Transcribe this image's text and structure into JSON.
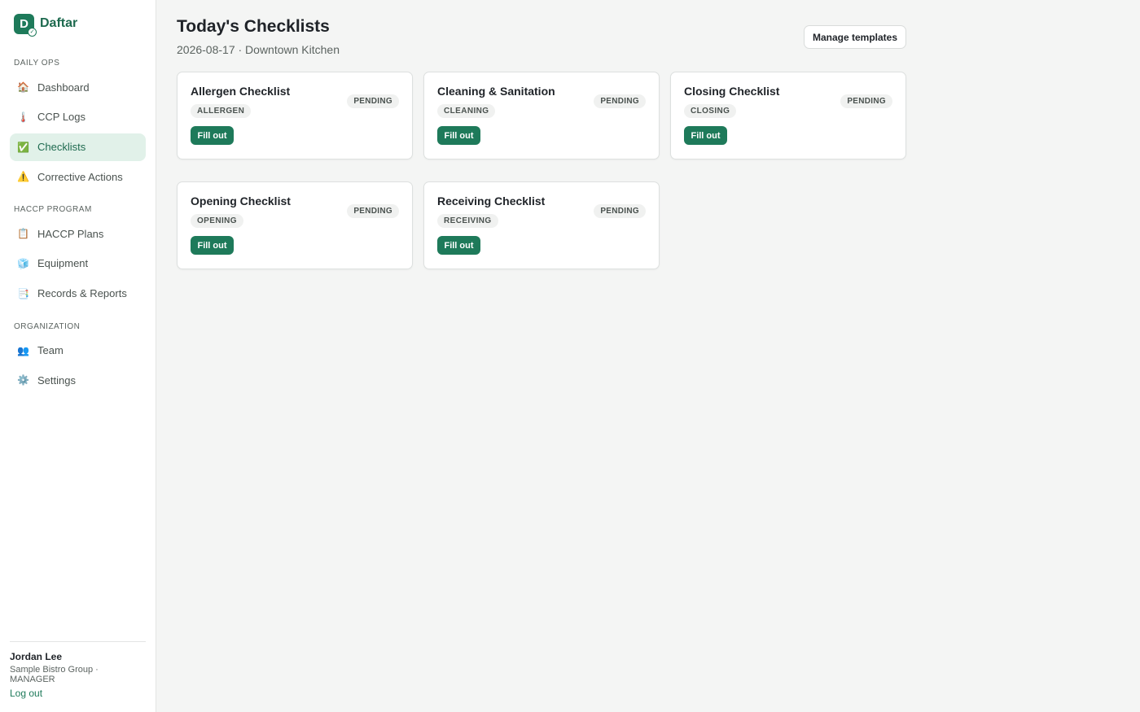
{
  "brand": {
    "name": "Daftar",
    "logo_icon": "daftar-logo-icon",
    "accent": "#1e7a5a"
  },
  "sidebar": {
    "sections": [
      {
        "label": "DAILY OPS",
        "items": [
          {
            "label": "Dashboard",
            "icon": "🏠",
            "active": false
          },
          {
            "label": "CCP Logs",
            "icon": "🌡️",
            "active": false
          },
          {
            "label": "Checklists",
            "icon": "✅",
            "active": true
          },
          {
            "label": "Corrective Actions",
            "icon": "⚠️",
            "active": false
          }
        ]
      },
      {
        "label": "HACCP PROGRAM",
        "items": [
          {
            "label": "HACCP Plans",
            "icon": "📋",
            "active": false
          },
          {
            "label": "Equipment",
            "icon": "🧊",
            "active": false
          },
          {
            "label": "Records & Reports",
            "icon": "📑",
            "active": false
          }
        ]
      },
      {
        "label": "ORGANIZATION",
        "items": [
          {
            "label": "Team",
            "icon": "👥",
            "active": false
          },
          {
            "label": "Settings",
            "icon": "⚙️",
            "active": false
          }
        ]
      }
    ],
    "user": {
      "name": "Jordan Lee",
      "org_role": "Sample Bistro Group · MANAGER",
      "logout_label": "Log out"
    }
  },
  "header": {
    "title": "Today's Checklists",
    "subtitle": "2026-08-17 · Downtown Kitchen",
    "manage_label": "Manage templates"
  },
  "checklists": [
    {
      "title": "Allergen Checklist",
      "tag": "ALLERGEN",
      "status": "PENDING",
      "action": "Fill out"
    },
    {
      "title": "Cleaning & Sanitation",
      "tag": "CLEANING",
      "status": "PENDING",
      "action": "Fill out"
    },
    {
      "title": "Closing Checklist",
      "tag": "CLOSING",
      "status": "PENDING",
      "action": "Fill out"
    },
    {
      "title": "Opening Checklist",
      "tag": "OPENING",
      "status": "PENDING",
      "action": "Fill out"
    },
    {
      "title": "Receiving Checklist",
      "tag": "RECEIVING",
      "status": "PENDING",
      "action": "Fill out"
    }
  ]
}
